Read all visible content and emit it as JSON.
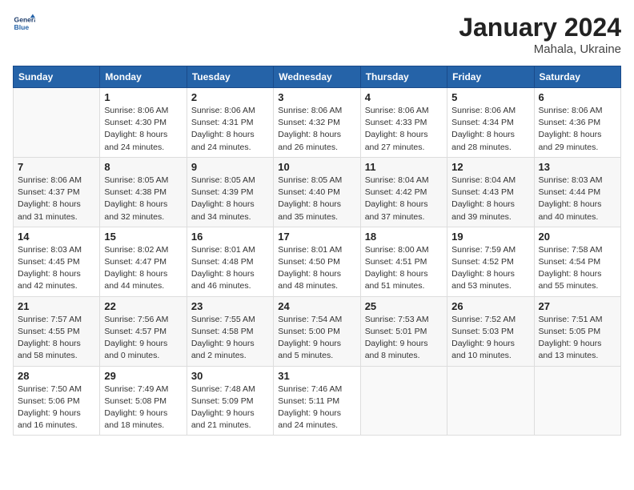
{
  "header": {
    "logo_line1": "General",
    "logo_line2": "Blue",
    "title": "January 2024",
    "subtitle": "Mahala, Ukraine"
  },
  "weekdays": [
    "Sunday",
    "Monday",
    "Tuesday",
    "Wednesday",
    "Thursday",
    "Friday",
    "Saturday"
  ],
  "weeks": [
    [
      {
        "num": "",
        "sunrise": "",
        "sunset": "",
        "daylight": ""
      },
      {
        "num": "1",
        "sunrise": "Sunrise: 8:06 AM",
        "sunset": "Sunset: 4:30 PM",
        "daylight": "Daylight: 8 hours and 24 minutes."
      },
      {
        "num": "2",
        "sunrise": "Sunrise: 8:06 AM",
        "sunset": "Sunset: 4:31 PM",
        "daylight": "Daylight: 8 hours and 24 minutes."
      },
      {
        "num": "3",
        "sunrise": "Sunrise: 8:06 AM",
        "sunset": "Sunset: 4:32 PM",
        "daylight": "Daylight: 8 hours and 26 minutes."
      },
      {
        "num": "4",
        "sunrise": "Sunrise: 8:06 AM",
        "sunset": "Sunset: 4:33 PM",
        "daylight": "Daylight: 8 hours and 27 minutes."
      },
      {
        "num": "5",
        "sunrise": "Sunrise: 8:06 AM",
        "sunset": "Sunset: 4:34 PM",
        "daylight": "Daylight: 8 hours and 28 minutes."
      },
      {
        "num": "6",
        "sunrise": "Sunrise: 8:06 AM",
        "sunset": "Sunset: 4:36 PM",
        "daylight": "Daylight: 8 hours and 29 minutes."
      }
    ],
    [
      {
        "num": "7",
        "sunrise": "Sunrise: 8:06 AM",
        "sunset": "Sunset: 4:37 PM",
        "daylight": "Daylight: 8 hours and 31 minutes."
      },
      {
        "num": "8",
        "sunrise": "Sunrise: 8:05 AM",
        "sunset": "Sunset: 4:38 PM",
        "daylight": "Daylight: 8 hours and 32 minutes."
      },
      {
        "num": "9",
        "sunrise": "Sunrise: 8:05 AM",
        "sunset": "Sunset: 4:39 PM",
        "daylight": "Daylight: 8 hours and 34 minutes."
      },
      {
        "num": "10",
        "sunrise": "Sunrise: 8:05 AM",
        "sunset": "Sunset: 4:40 PM",
        "daylight": "Daylight: 8 hours and 35 minutes."
      },
      {
        "num": "11",
        "sunrise": "Sunrise: 8:04 AM",
        "sunset": "Sunset: 4:42 PM",
        "daylight": "Daylight: 8 hours and 37 minutes."
      },
      {
        "num": "12",
        "sunrise": "Sunrise: 8:04 AM",
        "sunset": "Sunset: 4:43 PM",
        "daylight": "Daylight: 8 hours and 39 minutes."
      },
      {
        "num": "13",
        "sunrise": "Sunrise: 8:03 AM",
        "sunset": "Sunset: 4:44 PM",
        "daylight": "Daylight: 8 hours and 40 minutes."
      }
    ],
    [
      {
        "num": "14",
        "sunrise": "Sunrise: 8:03 AM",
        "sunset": "Sunset: 4:45 PM",
        "daylight": "Daylight: 8 hours and 42 minutes."
      },
      {
        "num": "15",
        "sunrise": "Sunrise: 8:02 AM",
        "sunset": "Sunset: 4:47 PM",
        "daylight": "Daylight: 8 hours and 44 minutes."
      },
      {
        "num": "16",
        "sunrise": "Sunrise: 8:01 AM",
        "sunset": "Sunset: 4:48 PM",
        "daylight": "Daylight: 8 hours and 46 minutes."
      },
      {
        "num": "17",
        "sunrise": "Sunrise: 8:01 AM",
        "sunset": "Sunset: 4:50 PM",
        "daylight": "Daylight: 8 hours and 48 minutes."
      },
      {
        "num": "18",
        "sunrise": "Sunrise: 8:00 AM",
        "sunset": "Sunset: 4:51 PM",
        "daylight": "Daylight: 8 hours and 51 minutes."
      },
      {
        "num": "19",
        "sunrise": "Sunrise: 7:59 AM",
        "sunset": "Sunset: 4:52 PM",
        "daylight": "Daylight: 8 hours and 53 minutes."
      },
      {
        "num": "20",
        "sunrise": "Sunrise: 7:58 AM",
        "sunset": "Sunset: 4:54 PM",
        "daylight": "Daylight: 8 hours and 55 minutes."
      }
    ],
    [
      {
        "num": "21",
        "sunrise": "Sunrise: 7:57 AM",
        "sunset": "Sunset: 4:55 PM",
        "daylight": "Daylight: 8 hours and 58 minutes."
      },
      {
        "num": "22",
        "sunrise": "Sunrise: 7:56 AM",
        "sunset": "Sunset: 4:57 PM",
        "daylight": "Daylight: 9 hours and 0 minutes."
      },
      {
        "num": "23",
        "sunrise": "Sunrise: 7:55 AM",
        "sunset": "Sunset: 4:58 PM",
        "daylight": "Daylight: 9 hours and 2 minutes."
      },
      {
        "num": "24",
        "sunrise": "Sunrise: 7:54 AM",
        "sunset": "Sunset: 5:00 PM",
        "daylight": "Daylight: 9 hours and 5 minutes."
      },
      {
        "num": "25",
        "sunrise": "Sunrise: 7:53 AM",
        "sunset": "Sunset: 5:01 PM",
        "daylight": "Daylight: 9 hours and 8 minutes."
      },
      {
        "num": "26",
        "sunrise": "Sunrise: 7:52 AM",
        "sunset": "Sunset: 5:03 PM",
        "daylight": "Daylight: 9 hours and 10 minutes."
      },
      {
        "num": "27",
        "sunrise": "Sunrise: 7:51 AM",
        "sunset": "Sunset: 5:05 PM",
        "daylight": "Daylight: 9 hours and 13 minutes."
      }
    ],
    [
      {
        "num": "28",
        "sunrise": "Sunrise: 7:50 AM",
        "sunset": "Sunset: 5:06 PM",
        "daylight": "Daylight: 9 hours and 16 minutes."
      },
      {
        "num": "29",
        "sunrise": "Sunrise: 7:49 AM",
        "sunset": "Sunset: 5:08 PM",
        "daylight": "Daylight: 9 hours and 18 minutes."
      },
      {
        "num": "30",
        "sunrise": "Sunrise: 7:48 AM",
        "sunset": "Sunset: 5:09 PM",
        "daylight": "Daylight: 9 hours and 21 minutes."
      },
      {
        "num": "31",
        "sunrise": "Sunrise: 7:46 AM",
        "sunset": "Sunset: 5:11 PM",
        "daylight": "Daylight: 9 hours and 24 minutes."
      },
      {
        "num": "",
        "sunrise": "",
        "sunset": "",
        "daylight": ""
      },
      {
        "num": "",
        "sunrise": "",
        "sunset": "",
        "daylight": ""
      },
      {
        "num": "",
        "sunrise": "",
        "sunset": "",
        "daylight": ""
      }
    ]
  ]
}
